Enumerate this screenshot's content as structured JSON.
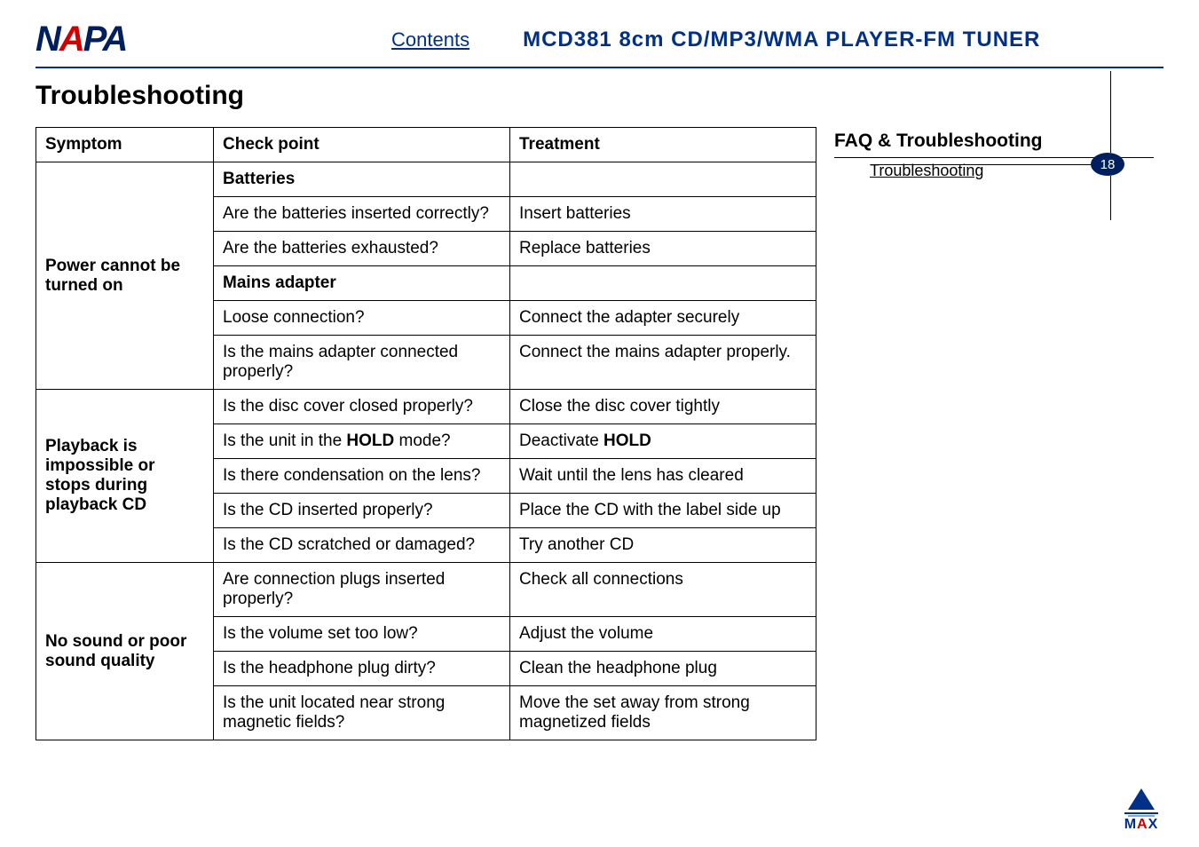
{
  "header": {
    "logo_text_1": "N",
    "logo_text_2": "A",
    "logo_text_3": "PA",
    "contents_link": "Contents",
    "product_title": "MCD381  8cm  CD/MP3/WMA  PLAYER-FM  TUNER"
  },
  "page_title": "Troubleshooting",
  "sidebar": {
    "title": "FAQ & Troubleshooting",
    "items": [
      "Troubleshooting"
    ],
    "page_number": "18"
  },
  "table": {
    "headers": [
      "Symptom",
      "Check point",
      "Treatment"
    ],
    "sections": [
      {
        "symptom": "Power cannot be turned on",
        "rows": [
          {
            "check": "Batteries",
            "treatment": "",
            "check_bold": true,
            "treat_empty": true
          },
          {
            "check": "Are the batteries inserted correctly?",
            "treatment": "Insert batteries",
            "check_justify": true
          },
          {
            "check": "Are the batteries exhausted?",
            "treatment": "Replace batteries"
          },
          {
            "check": "Mains adapter",
            "treatment": "",
            "check_bold": true,
            "treat_empty": true
          },
          {
            "check": "Loose connection?",
            "treatment": "Connect the adapter securely"
          },
          {
            "check": "Is the mains adapter connected properly?",
            "treatment": "Connect the mains adapter properly.",
            "check_justify": true
          }
        ]
      },
      {
        "symptom": "Playback is impossible or stops during playback CD",
        "rows": [
          {
            "check": "Is the disc cover closed properly?",
            "treatment": "Close the disc cover tightly"
          },
          {
            "check_html": "Is the unit in the <b>HOLD</b> mode?",
            "treatment_html": "Deactivate <b>HOLD</b>"
          },
          {
            "check": "Is there condensation on the lens?",
            "treatment": "Wait until the lens has cleared",
            "treat_justify": true
          },
          {
            "check": "Is the CD inserted properly?",
            "treatment": "Place the CD with the label side up"
          },
          {
            "check": "Is the CD scratched or damaged?",
            "treatment": "Try another CD"
          }
        ]
      },
      {
        "symptom": "No sound or poor sound quality",
        "rows": [
          {
            "check": "Are connection plugs inserted properly?",
            "treatment": "Check all connections",
            "check_justify": true
          },
          {
            "check": "Is the volume set too low?",
            "treatment": "Adjust the volume"
          },
          {
            "check": "Is the headphone plug dirty?",
            "treatment": "Clean the headphone plug"
          },
          {
            "check": "Is the unit located near strong magnetic fields?",
            "treatment": "Move the set away from strong magnetized fields",
            "check_justify": true,
            "treat_justify": true
          }
        ]
      }
    ]
  },
  "footer": {
    "max_1": "M",
    "max_2": "A",
    "max_3": "X"
  }
}
